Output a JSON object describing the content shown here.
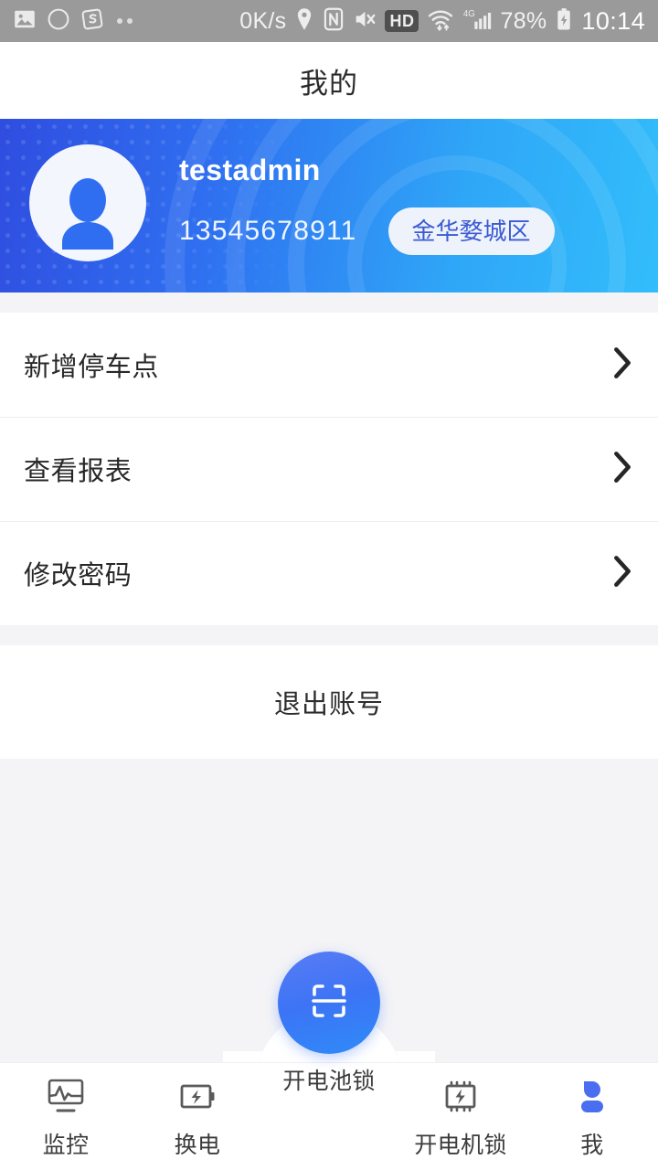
{
  "status_bar": {
    "network_speed": "0K/s",
    "hd_badge": "HD",
    "network_type": "4G",
    "battery_percent": "78%",
    "clock": "10:14",
    "icons": [
      "image-icon",
      "opera-icon",
      "sogou-icon",
      "more-dots-icon",
      "location-pin-icon",
      "nfc-icon",
      "mute-icon",
      "hd-icon",
      "wifi-icon",
      "signal-icon",
      "battery-charging-icon"
    ]
  },
  "header": {
    "title": "我的"
  },
  "profile": {
    "avatar_icon": "user-avatar-icon",
    "username": "testadmin",
    "phone": "13545678911",
    "region": "金华婺城区",
    "gradient_start": "#2f4de0",
    "gradient_end": "#32bdfb",
    "region_text_color": "#3b5ad4"
  },
  "menu": {
    "items": [
      {
        "label": "新增停车点",
        "chevron": "chevron-right-icon"
      },
      {
        "label": "查看报表",
        "chevron": "chevron-right-icon"
      },
      {
        "label": "修改密码",
        "chevron": "chevron-right-icon"
      }
    ]
  },
  "logout": {
    "label": "退出账号"
  },
  "bottom_nav": {
    "active_color": "#4a6ef0",
    "inactive_color": "#5a5a5a",
    "items": [
      {
        "label": "监控",
        "icon": "monitor-waveform-icon",
        "active": false
      },
      {
        "label": "换电",
        "icon": "battery-bolt-icon",
        "active": false
      },
      {
        "label": "开电池锁",
        "icon": "scan-frame-icon",
        "active": false
      },
      {
        "label": "开电机锁",
        "icon": "motor-bolt-icon",
        "active": false
      },
      {
        "label": "我",
        "icon": "person-icon",
        "active": true
      }
    ]
  }
}
